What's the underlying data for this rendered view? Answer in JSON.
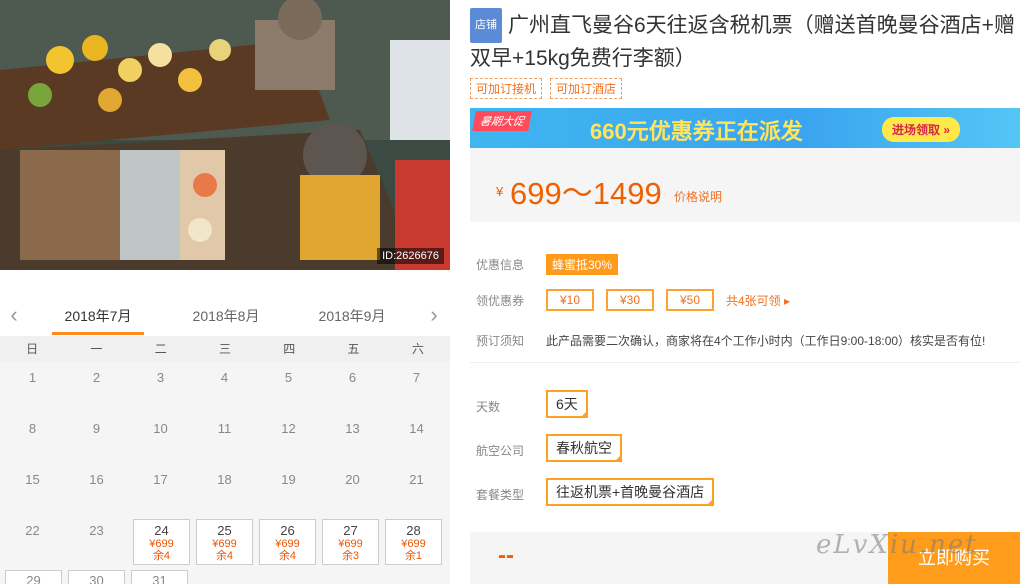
{
  "photo": {
    "id_label": "ID:2626676"
  },
  "calendar": {
    "prev_icon": "chevron-left-icon",
    "next_icon": "chevron-right-icon",
    "months": [
      "2018年7月",
      "2018年8月",
      "2018年9月"
    ],
    "weekdays": [
      "日",
      "一",
      "二",
      "三",
      "四",
      "五",
      "六"
    ],
    "rows": [
      [
        {
          "d": "1"
        },
        {
          "d": "2"
        },
        {
          "d": "3"
        },
        {
          "d": "4"
        },
        {
          "d": "5"
        },
        {
          "d": "6"
        },
        {
          "d": "7"
        }
      ],
      [
        {
          "d": "8"
        },
        {
          "d": "9"
        },
        {
          "d": "10"
        },
        {
          "d": "11"
        },
        {
          "d": "12"
        },
        {
          "d": "13"
        },
        {
          "d": "14"
        }
      ],
      [
        {
          "d": "15"
        },
        {
          "d": "16"
        },
        {
          "d": "17"
        },
        {
          "d": "18"
        },
        {
          "d": "19"
        },
        {
          "d": "20"
        },
        {
          "d": "21"
        }
      ],
      [
        {
          "d": "22"
        },
        {
          "d": "23"
        },
        {
          "d": "24",
          "p": "¥699",
          "r": "余4"
        },
        {
          "d": "25",
          "p": "¥699",
          "r": "余4"
        },
        {
          "d": "26",
          "p": "¥699",
          "r": "余4"
        },
        {
          "d": "27",
          "p": "¥699",
          "r": "余3"
        },
        {
          "d": "28",
          "p": "¥699",
          "r": "余1"
        }
      ],
      [
        {
          "d": "29"
        },
        {
          "d": "30"
        },
        {
          "d": "31"
        }
      ]
    ]
  },
  "product": {
    "shop_tag": "店铺",
    "title": "广州直飞曼谷6天往返含税机票（赠送首晚曼谷酒店+赠双早+15kg免费行李额）",
    "tags": [
      "可加订接机",
      "可加订酒店"
    ]
  },
  "banner": {
    "tag": "暑期大促",
    "text": "660元优惠券正在派发",
    "button": "进场领取 »"
  },
  "price": {
    "symbol": "¥",
    "range": "699～1499",
    "note": "价格说明"
  },
  "info": {
    "promo_label": "优惠信息",
    "promo_badge": "蜂蜜抵30%",
    "coupon_label": "领优惠券",
    "coupons": [
      "¥10",
      "¥30",
      "¥50"
    ],
    "coupon_more": "共4张可领 ▸",
    "notice_label": "预订须知",
    "notice": "此产品需要二次确认，商家将在4个工作小时内（工作日9:00-18:00）核实是否有位!"
  },
  "options": {
    "days_label": "天数",
    "days_value": "6天",
    "airline_label": "航空公司",
    "airline_value": "春秋航空",
    "package_label": "套餐类型",
    "package_value": "往返机票+首晚曼谷酒店"
  },
  "buy": {
    "price_placeholder": "--",
    "button": "立即购买",
    "watermark": "eLvXiu.net"
  },
  "colors": {
    "accent": "#ff9c1b",
    "price": "#f06000",
    "shop_tag": "#5b8ad6"
  }
}
